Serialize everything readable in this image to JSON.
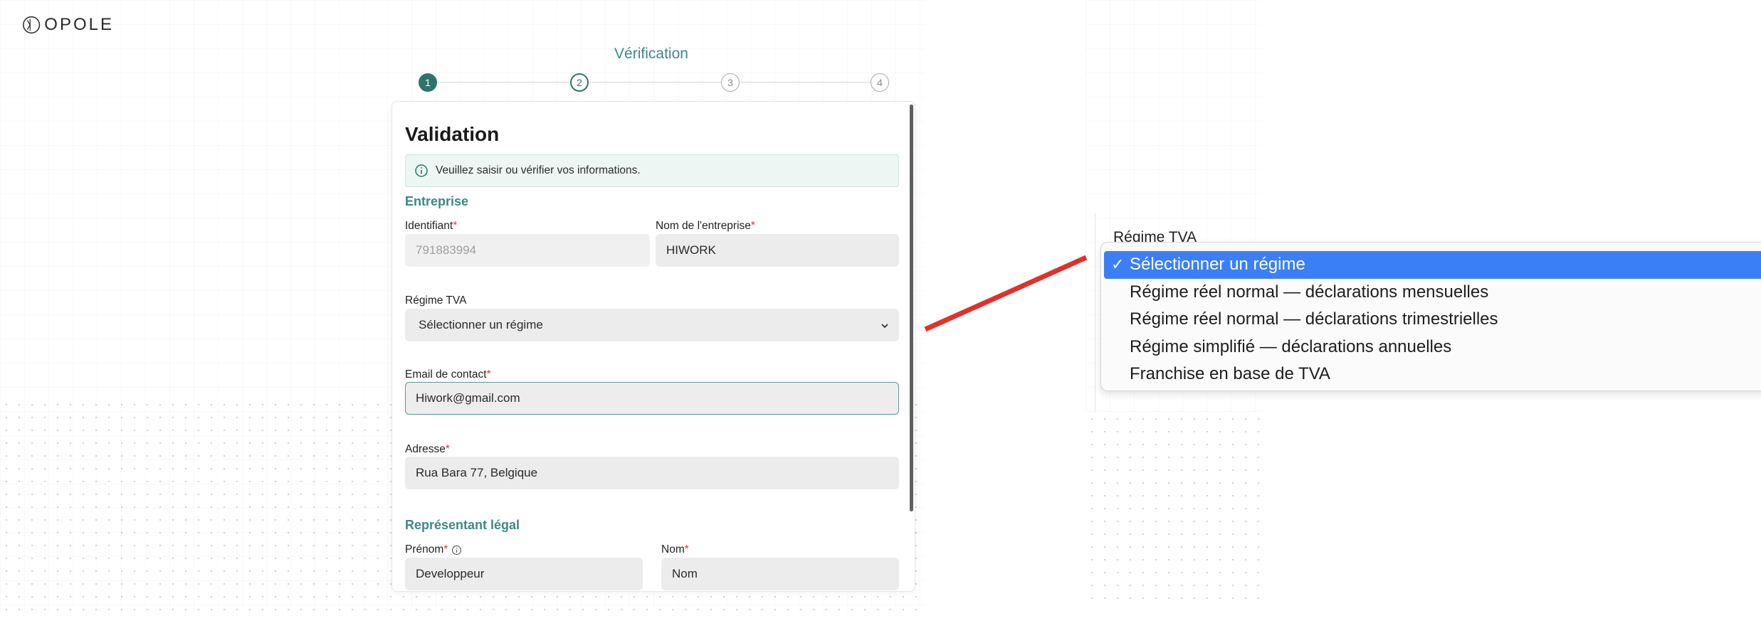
{
  "brand": {
    "logo_text": "OPOLE"
  },
  "stepper": {
    "title": "Vérification",
    "steps": [
      "1",
      "2",
      "3",
      "4"
    ]
  },
  "card": {
    "title": "Validation",
    "info_message": "Veuillez saisir ou vérifier vos informations.",
    "section_company": "Entreprise",
    "identifiant": {
      "label": "Identifiant",
      "value": "791883994"
    },
    "company_name": {
      "label": "Nom de l'entreprise",
      "value": "HIWORK"
    },
    "regime_tva": {
      "label": "Régime TVA",
      "value": "Sélectionner un régime"
    },
    "email": {
      "label": "Email de contact",
      "value": "Hiwork@gmail.com"
    },
    "address": {
      "label": "Adresse",
      "value": "Rua Bara 77, Belgique"
    },
    "section_legal": "Représentant légal",
    "firstname": {
      "label": "Prénom",
      "value": "Developpeur"
    },
    "lastname": {
      "label": "Nom",
      "value": "Nom"
    },
    "required_mark": "*"
  },
  "dropdown": {
    "label": "Régime TVA",
    "check": "✓",
    "options": [
      "Sélectionner un régime",
      "Régime réel normal — déclarations mensuelles",
      "Régime réel normal — déclarations trimestrielles",
      "Régime simplifié — déclarations annuelles",
      "Franchise en base de TVA"
    ],
    "selected_index": 0,
    "highlight_color": "#3a7ff6"
  },
  "colors": {
    "accent": "#3c8a80",
    "step_active": "#2f7469",
    "required": "#d23a3a",
    "annotation_line": "#e0322b"
  }
}
